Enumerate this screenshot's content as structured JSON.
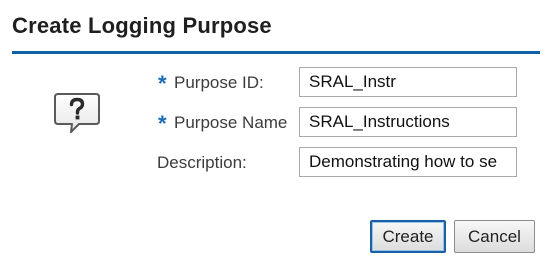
{
  "dialog": {
    "title": "Create Logging Purpose"
  },
  "icons": {
    "help": "help-speech-bubble-icon"
  },
  "form": {
    "required_marker": "*",
    "purpose_id": {
      "label": "Purpose ID:",
      "value": "SRAL_Instr",
      "required": true
    },
    "purpose_name": {
      "label": "Purpose Name",
      "value": "SRAL_Instructions",
      "required": true
    },
    "description": {
      "label": "Description:",
      "value": "Demonstrating how to se",
      "required": false
    }
  },
  "buttons": {
    "create": "Create",
    "cancel": "Cancel"
  },
  "colors": {
    "accent": "#1060a8",
    "required_marker": "#1a6cb5",
    "primary_button_border": "#1a5fa8"
  }
}
